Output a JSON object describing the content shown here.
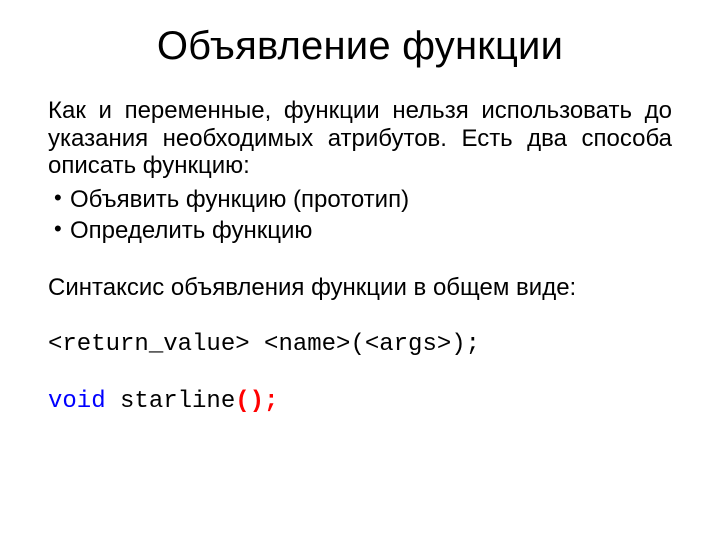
{
  "slide": {
    "title": "Объявление функции",
    "intro": "Как и переменные, функции нельзя использовать до указания необходимых атрибутов. Есть два способа описать функцию:",
    "bullets": [
      "Объявить функцию (прототип)",
      "Определить функцию"
    ],
    "syntax_label": "Синтаксис объявления функции в общем виде:",
    "syntax_template": "<return_value> <name>(<args>);",
    "example": {
      "keyword": "void",
      "space": " ",
      "name": "starline",
      "open": "(",
      "close": ")",
      "semi": ";"
    },
    "colors": {
      "text": "#000000",
      "keyword": "#0000ff",
      "paren": "#ff0000",
      "background": "#ffffff"
    }
  }
}
